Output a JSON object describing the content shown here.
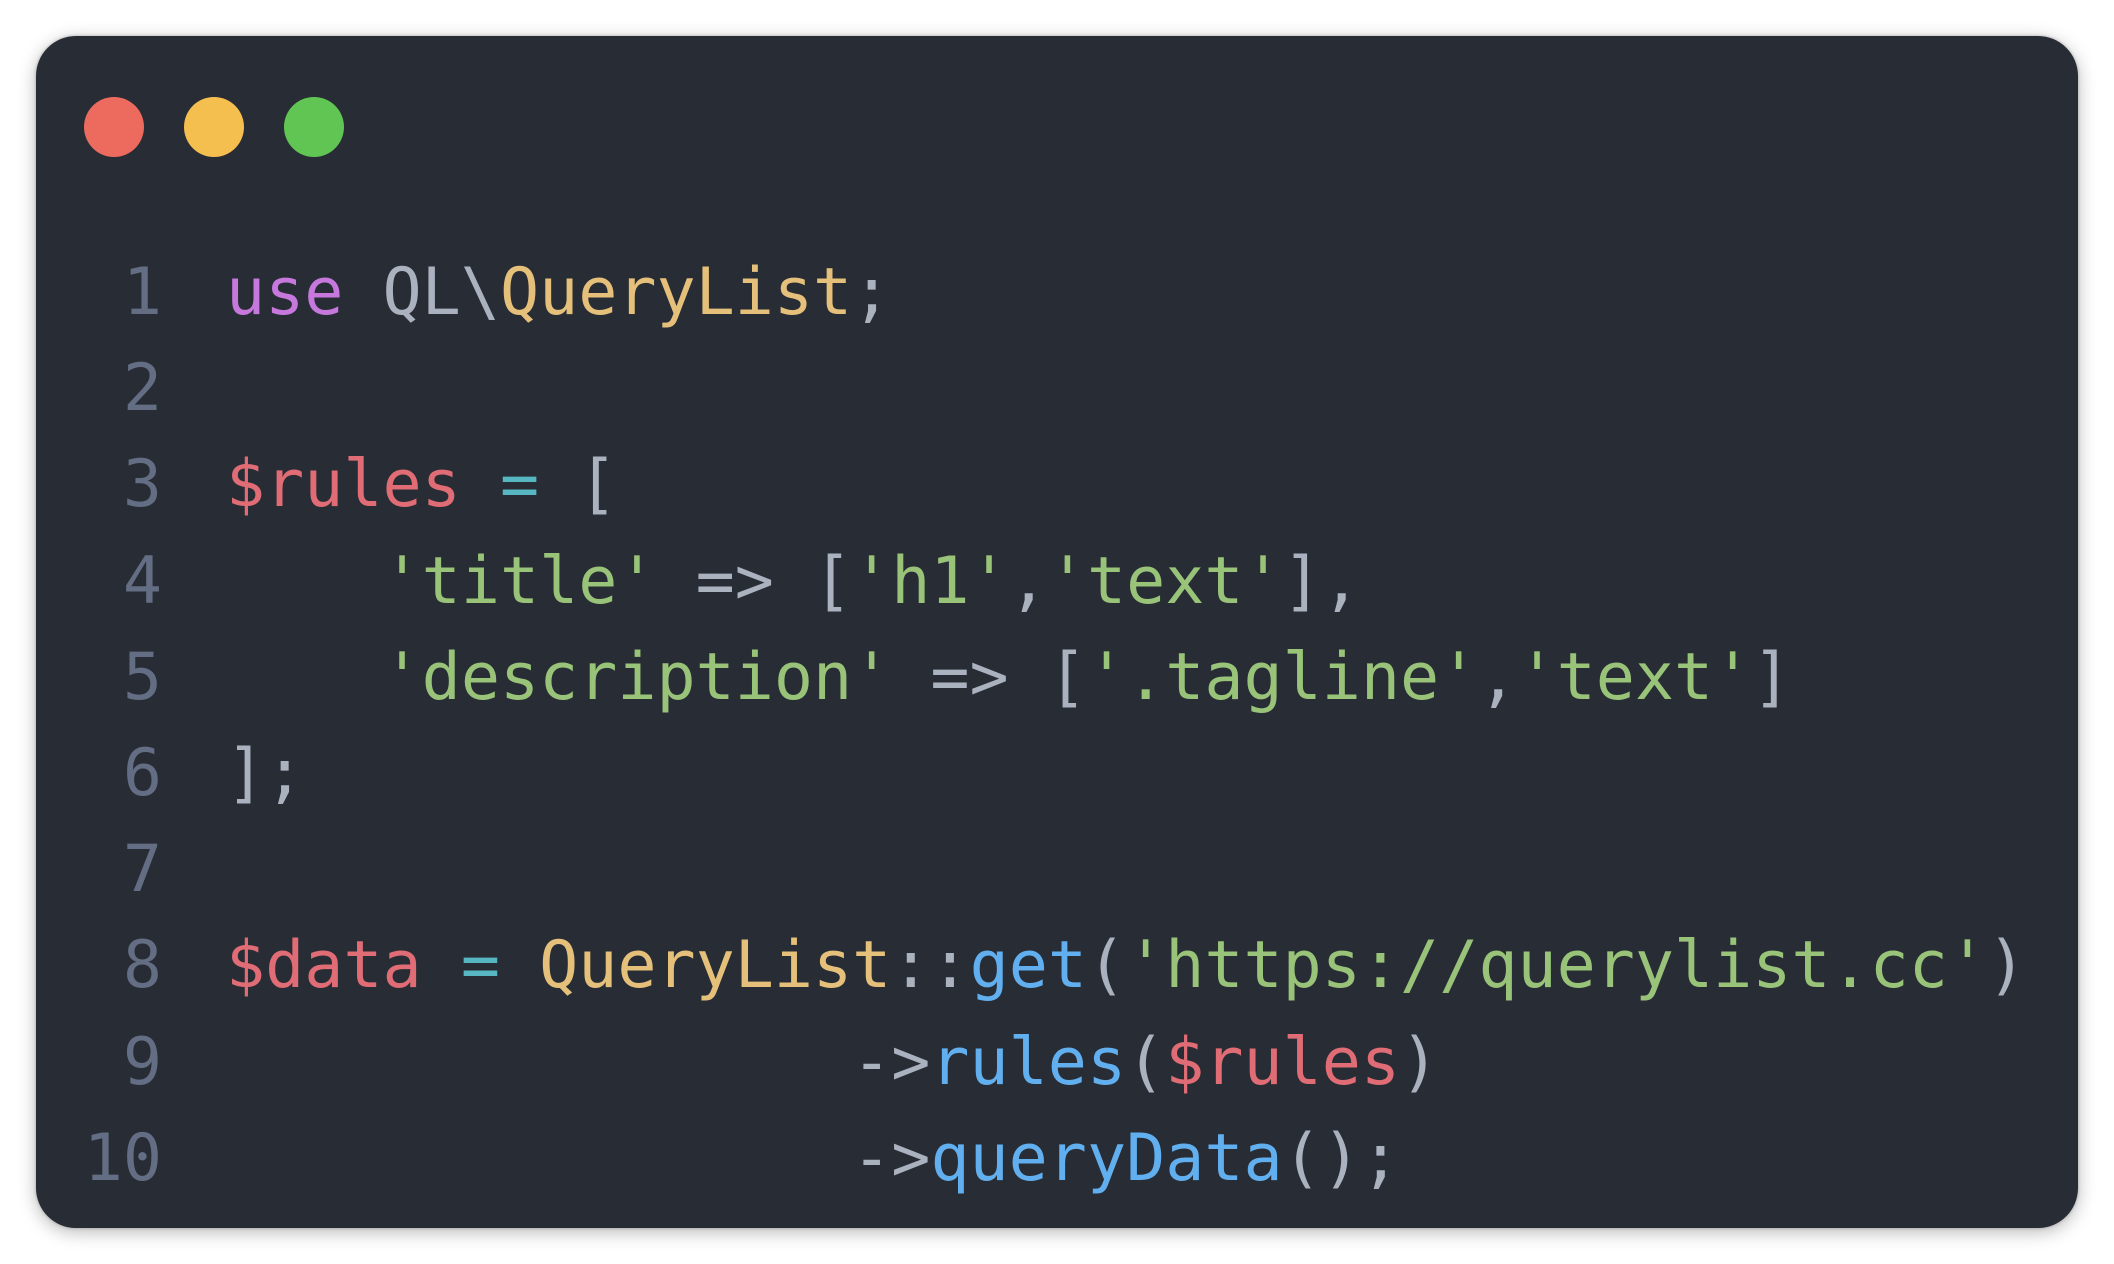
{
  "colors": {
    "background": "#282c34",
    "line_number": "#636d83",
    "keyword": "#c678dd",
    "class_name": "#e5c07b",
    "variable": "#e06c75",
    "operator": "#56b6c2",
    "string": "#98c379",
    "function": "#61afef",
    "punctuation": "#abb2bf"
  },
  "window_controls": [
    {
      "name": "close",
      "color": "#ed6a5e"
    },
    {
      "name": "minimize",
      "color": "#f5bf4f"
    },
    {
      "name": "maximize",
      "color": "#61c554"
    }
  ],
  "code_lines": [
    {
      "number": "1",
      "tokens": [
        {
          "text": "use",
          "type": "keyword"
        },
        {
          "text": " QL\\",
          "type": "punctuation"
        },
        {
          "text": "QueryList",
          "type": "class_name"
        },
        {
          "text": ";",
          "type": "punctuation"
        }
      ]
    },
    {
      "number": "2",
      "tokens": []
    },
    {
      "number": "3",
      "tokens": [
        {
          "text": "$rules",
          "type": "variable"
        },
        {
          "text": " ",
          "type": "punctuation"
        },
        {
          "text": "=",
          "type": "operator"
        },
        {
          "text": " [",
          "type": "punctuation"
        }
      ]
    },
    {
      "number": "4",
      "tokens": [
        {
          "text": "    ",
          "type": "punctuation"
        },
        {
          "text": "'title'",
          "type": "string"
        },
        {
          "text": " => [",
          "type": "punctuation"
        },
        {
          "text": "'h1'",
          "type": "string"
        },
        {
          "text": ",",
          "type": "punctuation"
        },
        {
          "text": "'text'",
          "type": "string"
        },
        {
          "text": "],",
          "type": "punctuation"
        }
      ]
    },
    {
      "number": "5",
      "tokens": [
        {
          "text": "    ",
          "type": "punctuation"
        },
        {
          "text": "'description'",
          "type": "string"
        },
        {
          "text": " => [",
          "type": "punctuation"
        },
        {
          "text": "'.tagline'",
          "type": "string"
        },
        {
          "text": ",",
          "type": "punctuation"
        },
        {
          "text": "'text'",
          "type": "string"
        },
        {
          "text": "]",
          "type": "punctuation"
        }
      ]
    },
    {
      "number": "6",
      "tokens": [
        {
          "text": "];",
          "type": "punctuation"
        }
      ]
    },
    {
      "number": "7",
      "tokens": []
    },
    {
      "number": "8",
      "tokens": [
        {
          "text": "$data",
          "type": "variable"
        },
        {
          "text": " ",
          "type": "punctuation"
        },
        {
          "text": "=",
          "type": "operator"
        },
        {
          "text": " ",
          "type": "punctuation"
        },
        {
          "text": "QueryList",
          "type": "class_name"
        },
        {
          "text": "::",
          "type": "punctuation"
        },
        {
          "text": "get",
          "type": "function"
        },
        {
          "text": "(",
          "type": "punctuation"
        },
        {
          "text": "'https://querylist.cc'",
          "type": "string"
        },
        {
          "text": ")",
          "type": "punctuation"
        }
      ]
    },
    {
      "number": "9",
      "tokens": [
        {
          "text": "                ->",
          "type": "punctuation"
        },
        {
          "text": "rules",
          "type": "function"
        },
        {
          "text": "(",
          "type": "punctuation"
        },
        {
          "text": "$rules",
          "type": "variable"
        },
        {
          "text": ")",
          "type": "punctuation"
        }
      ]
    },
    {
      "number": "10",
      "tokens": [
        {
          "text": "                ->",
          "type": "punctuation"
        },
        {
          "text": "queryData",
          "type": "function"
        },
        {
          "text": "();",
          "type": "punctuation"
        }
      ]
    }
  ]
}
